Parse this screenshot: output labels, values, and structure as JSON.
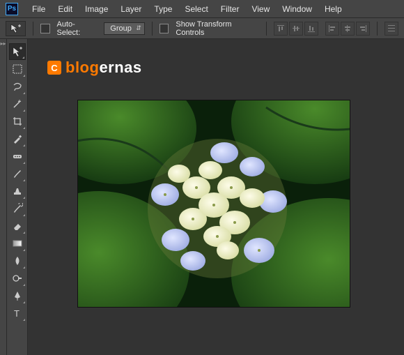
{
  "app": {
    "short": "Ps"
  },
  "menu": {
    "file": "File",
    "edit": "Edit",
    "image": "Image",
    "layer": "Layer",
    "type": "Type",
    "select": "Select",
    "filter": "Filter",
    "view": "View",
    "window": "Window",
    "help": "Help"
  },
  "options": {
    "auto_select_label": "Auto-Select:",
    "group_label": "Group",
    "show_transform_label": "Show Transform Controls"
  },
  "brand": {
    "badge": "C",
    "part1": "blog",
    "part2": "ernas"
  },
  "colors": {
    "accent": "#ff7a00",
    "ps_blue": "#3fa9f5"
  }
}
